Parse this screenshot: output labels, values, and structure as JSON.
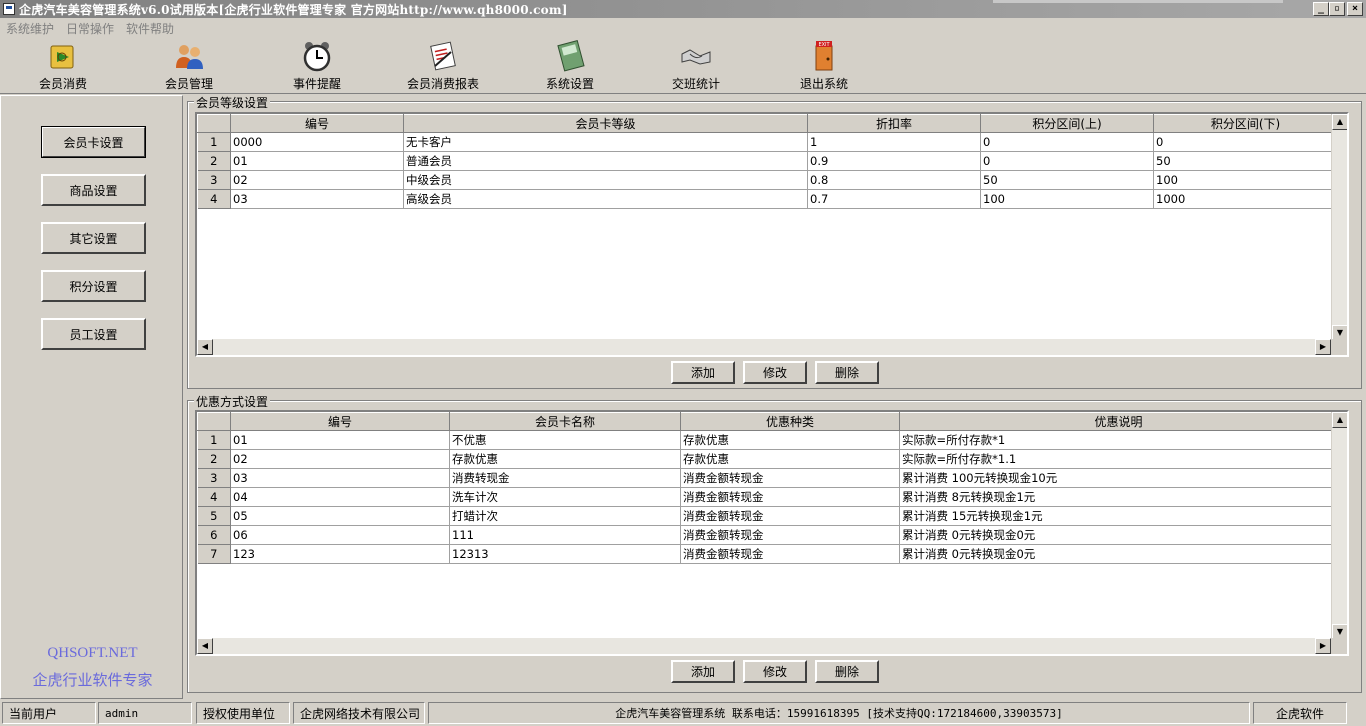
{
  "window": {
    "title": "企虎汽车美容管理系统v6.0试用版本[企虎行业软件管理专家 官方网站http://www.qh8000.com]",
    "buttons": [
      "_",
      "▫",
      "×"
    ]
  },
  "menu": [
    "系统维护",
    "日常操作",
    "软件帮助"
  ],
  "toolbar": [
    {
      "label": "会员消费",
      "icon": "money-icon"
    },
    {
      "label": "会员管理",
      "icon": "users-icon"
    },
    {
      "label": "事件提醒",
      "icon": "alarm-clock-icon"
    },
    {
      "label": "会员消费报表",
      "icon": "report-icon"
    },
    {
      "label": "系统设置",
      "icon": "settings-book-icon"
    },
    {
      "label": "交班统计",
      "icon": "handshake-icon"
    },
    {
      "label": "退出系统",
      "icon": "exit-door-icon"
    }
  ],
  "nav": [
    "会员卡设置",
    "商品设置",
    "其它设置",
    "积分设置",
    "员工设置"
  ],
  "brand": {
    "line1": "QHSOFT.NET",
    "line2": "企虎行业软件专家"
  },
  "level_group": {
    "title": "会员等级设置",
    "columns": [
      "编号",
      "会员卡等级",
      "折扣率",
      "积分区间(上)",
      "积分区间(下)"
    ],
    "rows": [
      [
        "1",
        "0000",
        "无卡客户",
        "1",
        "0",
        "0"
      ],
      [
        "2",
        "01",
        "普通会员",
        "0.9",
        "0",
        "50"
      ],
      [
        "3",
        "02",
        "中级会员",
        "0.8",
        "50",
        "100"
      ],
      [
        "4",
        "03",
        "高级会员",
        "0.7",
        "100",
        "1000"
      ]
    ],
    "buttons": [
      "添加",
      "修改",
      "删除"
    ]
  },
  "discount_group": {
    "title": "优惠方式设置",
    "columns": [
      "编号",
      "会员卡名称",
      "优惠种类",
      "优惠说明"
    ],
    "rows": [
      [
        "1",
        "01",
        "不优惠",
        "存款优惠",
        "实际款=所付存款*1"
      ],
      [
        "2",
        "02",
        "存款优惠",
        "存款优惠",
        "实际款=所付存款*1.1"
      ],
      [
        "3",
        "03",
        "消费转现金",
        "消费金额转现金",
        "累计消费 100元转换现金10元"
      ],
      [
        "4",
        "04",
        "洗车计次",
        "消费金额转现金",
        "累计消费 8元转换现金1元"
      ],
      [
        "5",
        "05",
        "打蜡计次",
        "消费金额转现金",
        "累计消费 15元转换现金1元"
      ],
      [
        "6",
        "06",
        "111",
        "消费金额转现金",
        "累计消费 0元转换现金0元"
      ],
      [
        "7",
        "123",
        "12313",
        "消费金额转现金",
        "累计消费 0元转换现金0元"
      ]
    ],
    "buttons": [
      "添加",
      "修改",
      "删除"
    ]
  },
  "status": {
    "user_label": "当前用户",
    "user": "admin",
    "licensee_label": "授权使用单位",
    "licensee": "企虎网络技术有限公司",
    "info": "企虎汽车美容管理系统 联系电话：15991618395 [技术支持QQ:172184600,33903573]",
    "brand": "企虎软件"
  }
}
